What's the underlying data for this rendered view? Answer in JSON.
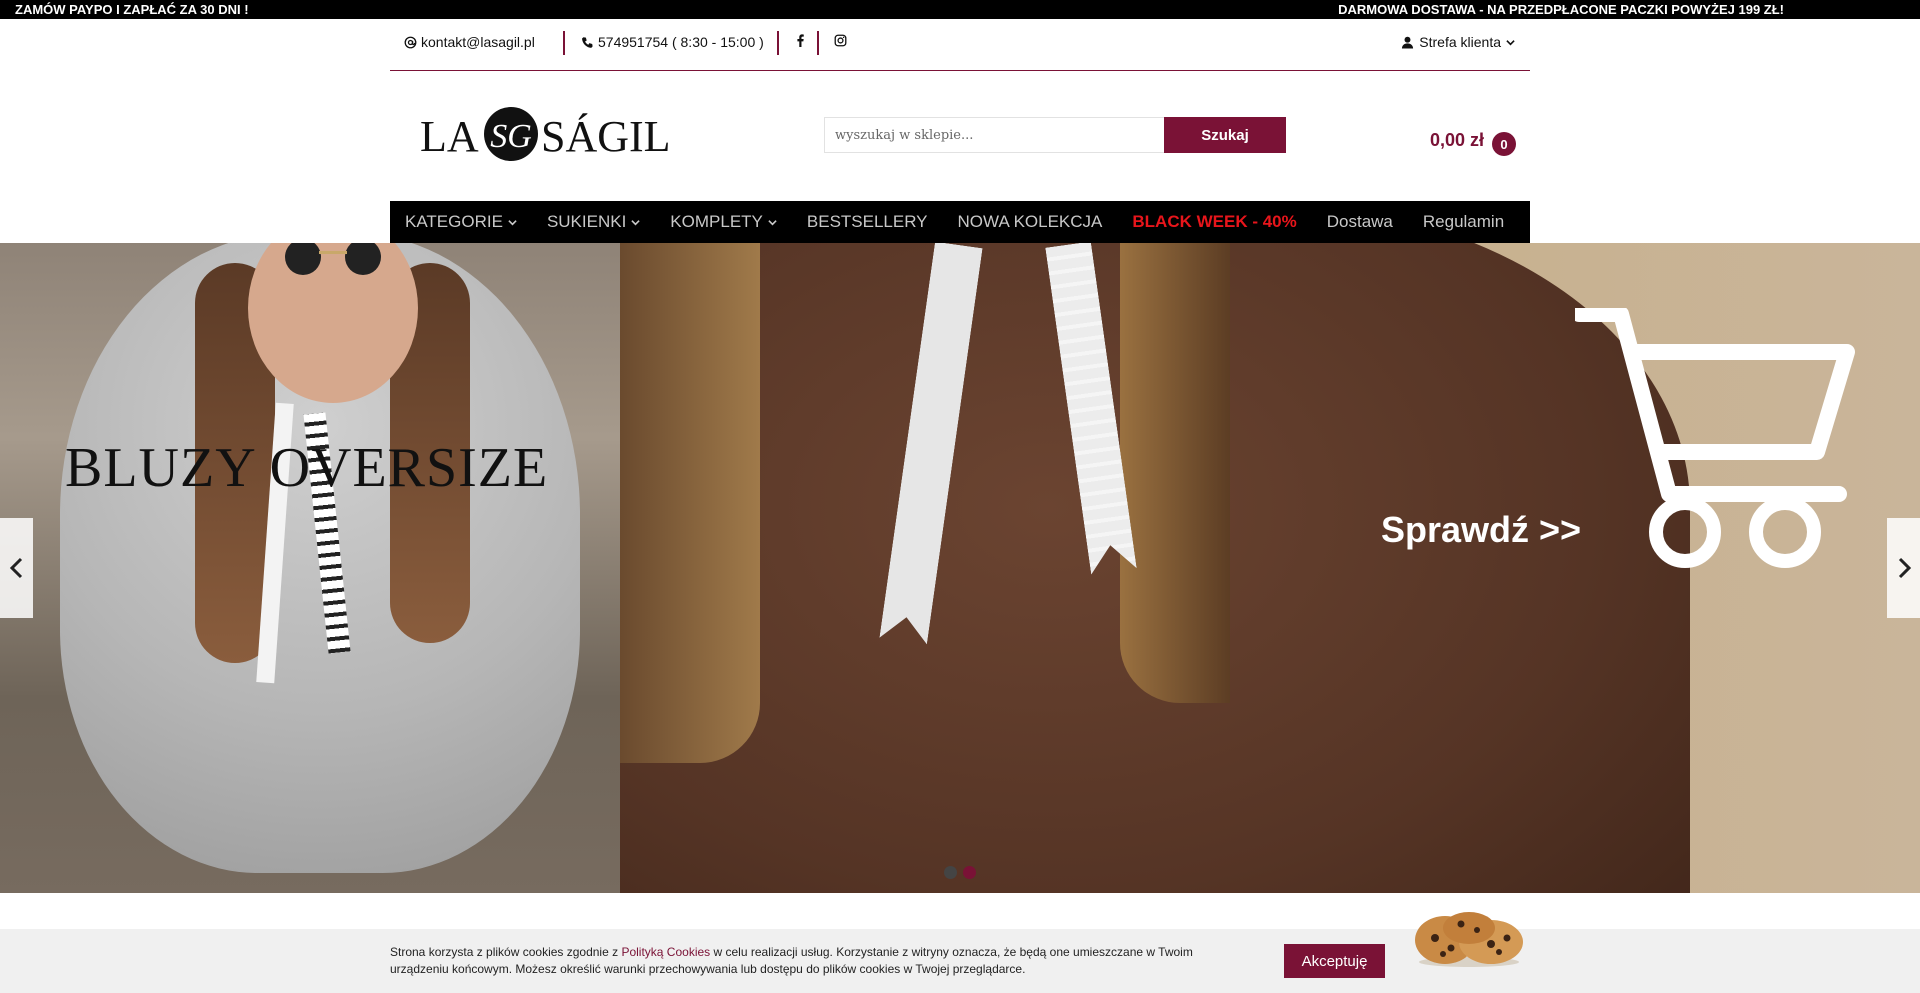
{
  "promo": {
    "left": "ZAMÓW PAYPO I ZAPŁAĆ ZA 30 DNI !",
    "right": "DARMOWA DOSTAWA - NA PRZEDPŁACONE PACZKI POWYŻEJ 199 ZŁ!"
  },
  "contact": {
    "email": "kontakt@lasagil.pl",
    "phone": "574951754 ( 8:30 - 15:00 )",
    "client_zone": "Strefa klienta"
  },
  "logo": {
    "left": "LA",
    "right": "SÁGIL",
    "monogram": "SG"
  },
  "search": {
    "placeholder": "wyszukaj w sklepie...",
    "button": "Szukaj"
  },
  "cart": {
    "price": "0,00 zł",
    "count": "0"
  },
  "nav": [
    {
      "label": "KATEGORIE",
      "dropdown": true
    },
    {
      "label": "SUKIENKI",
      "dropdown": true
    },
    {
      "label": "KOMPLETY",
      "dropdown": true
    },
    {
      "label": "BESTSELLERY",
      "dropdown": false
    },
    {
      "label": "NOWA KOLEKCJA",
      "dropdown": false
    },
    {
      "label": "BLACK WEEK - 40%",
      "dropdown": false,
      "highlight": true
    },
    {
      "label": "Dostawa",
      "dropdown": false
    },
    {
      "label": "Regulamin",
      "dropdown": false
    }
  ],
  "hero": {
    "title": "BLUZY OVERSIZE",
    "cta": "Sprawdź >>",
    "slides": 2,
    "active_slide": 2
  },
  "cookie": {
    "text_before": "Strona korzysta z plików cookies zgodnie z ",
    "link": "Polityką Cookies",
    "text_after": " w celu realizacji usług. Korzystanie z witryny oznacza, że będą one umieszczane w Twoim urządzeniu końcowym. Możesz określić warunki przechowywania lub dostępu do plików cookies w Twojej przeglądarce.",
    "accept": "Akceptuję"
  },
  "colors": {
    "brand": "#7a1236",
    "highlight": "#e8151b",
    "nav_bg": "#000000"
  },
  "icons": [
    "at-icon",
    "phone-icon",
    "facebook-icon",
    "instagram-icon",
    "user-icon",
    "chevron-down-icon",
    "arrow-left-icon",
    "arrow-right-icon",
    "cart-icon",
    "cookies-image"
  ]
}
